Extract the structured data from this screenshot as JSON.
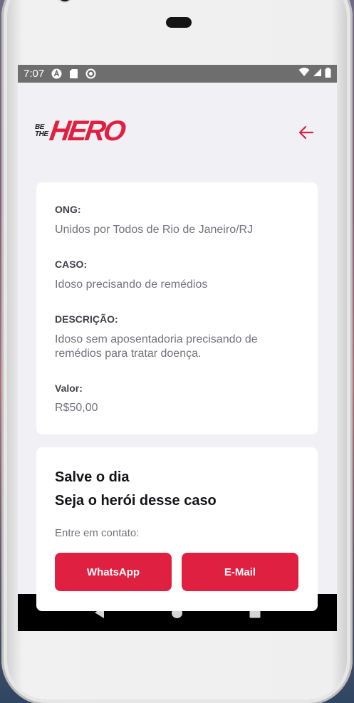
{
  "status_bar": {
    "time": "7:07"
  },
  "header": {
    "logo_small_top": "BE",
    "logo_small_bottom": "THE",
    "logo_big": "HERO",
    "back_icon": "arrow-left-icon",
    "accent_color": "#e02041"
  },
  "incident": {
    "ong_label": "ONG:",
    "ong_value": "Unidos por Todos de Rio de Janeiro/RJ",
    "caso_label": "CASO:",
    "caso_value": "Idoso precisando de remédios",
    "descricao_label": "DESCRIÇÃO:",
    "descricao_value": "Idoso sem aposentadoria precisando de remédios para tratar doença.",
    "valor_label": "Valor:",
    "valor_value": "R$50,00"
  },
  "contact": {
    "title_line1": "Salve o dia",
    "title_line2": "Seja o herói desse caso",
    "description": "Entre em contato:",
    "whatsapp_label": "WhatsApp",
    "email_label": "E-Mail"
  },
  "nav": {
    "back": "triangle-back-icon",
    "home": "circle-home-icon",
    "recents": "square-recents-icon"
  }
}
